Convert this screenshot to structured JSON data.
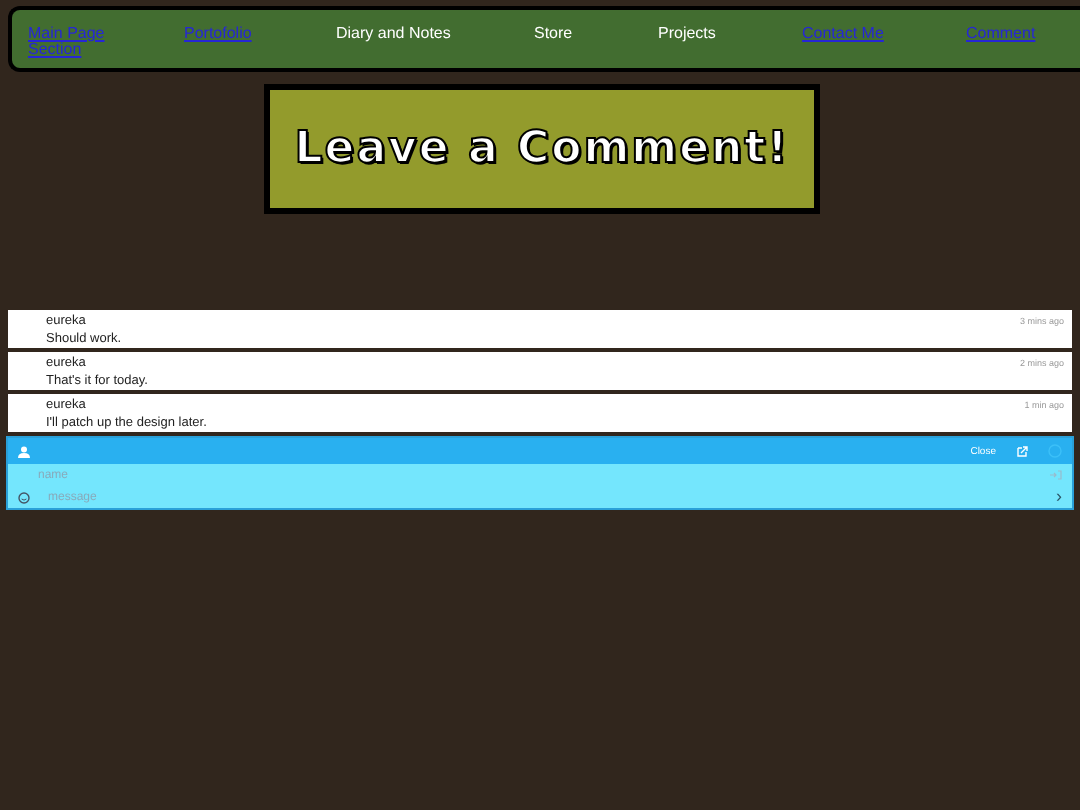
{
  "nav": [
    {
      "label": "Main Page Section",
      "kind": "link"
    },
    {
      "label": "Portofolio",
      "kind": "link"
    },
    {
      "label": "Diary and Notes",
      "kind": "text"
    },
    {
      "label": "Store",
      "kind": "text"
    },
    {
      "label": "Projects",
      "kind": "text"
    },
    {
      "label": "Contact Me",
      "kind": "link"
    },
    {
      "label": "Comment",
      "kind": "link"
    }
  ],
  "banner": {
    "title": "Leave a Comment!"
  },
  "comments": [
    {
      "author": "eureka",
      "text": "Should work.",
      "time": "3 mins ago"
    },
    {
      "author": "eureka",
      "text": "That's it for today.",
      "time": "2 mins ago"
    },
    {
      "author": "eureka",
      "text": "I'll patch up the design later.",
      "time": "1 min ago"
    }
  ],
  "chat": {
    "close": "Close",
    "name_placeholder": "name",
    "message_placeholder": "message",
    "send": "›"
  }
}
